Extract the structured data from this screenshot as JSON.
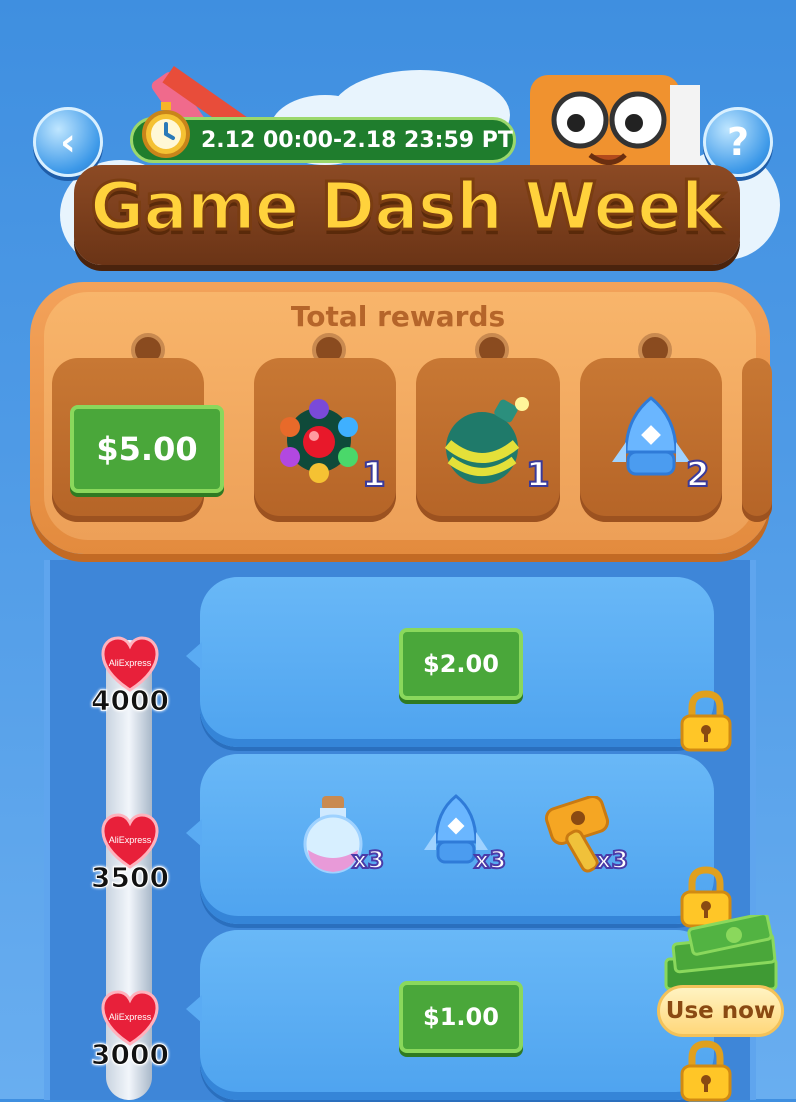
{
  "header": {
    "back_icon": "chevron-left-icon",
    "help_label": "?",
    "event_period": "2.12 00:00-2.18 23:59 PT",
    "title": "Game Dash Week"
  },
  "rewards_panel": {
    "title": "Total rewards",
    "items": [
      {
        "type": "cash",
        "label": "$5.00"
      },
      {
        "type": "rainbow-ball-icon",
        "count": "1"
      },
      {
        "type": "bomb-icon",
        "count": "1"
      },
      {
        "type": "rocket-icon",
        "count": "2"
      }
    ]
  },
  "tiers": [
    {
      "points": "4000",
      "badge": "AliExpress",
      "reward_label": "$2.00",
      "locked": true
    },
    {
      "points": "3500",
      "badge": "AliExpress",
      "rewards": [
        {
          "type": "potion-icon",
          "qty": "x3"
        },
        {
          "type": "rocket-icon",
          "qty": "x3"
        },
        {
          "type": "hammer-icon",
          "qty": "x3"
        }
      ],
      "locked": true
    },
    {
      "points": "3000",
      "badge": "AliExpress",
      "reward_label": "$1.00",
      "locked": true
    }
  ],
  "floating_cta": {
    "label": "Use now"
  },
  "colors": {
    "sky": "#4e9ae6",
    "wood": "#eda058",
    "cash_green": "#4aa73a",
    "title_gold": "#ffd23c"
  }
}
